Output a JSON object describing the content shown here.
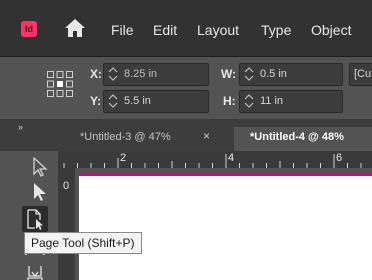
{
  "menubar": {
    "app_icon_text": "Id",
    "items": [
      "File",
      "Edit",
      "Layout",
      "Type",
      "Object"
    ]
  },
  "control_panel": {
    "x": {
      "label": "X:",
      "value": "8.25 in"
    },
    "y": {
      "label": "Y:",
      "value": "5.5 in"
    },
    "w": {
      "label": "W:",
      "value": "0.5 in"
    },
    "h": {
      "label": "H:",
      "value": "11 in"
    },
    "overflow_field": "[Cu"
  },
  "panel_toggle": "››",
  "tabs": [
    {
      "label": "*Untitled-3 @ 47%",
      "close": "×",
      "active": false
    },
    {
      "label": "*Untitled-4 @ 48%",
      "active": true
    }
  ],
  "ruler": {
    "h_marks": [
      "2",
      "4",
      "6"
    ],
    "v_marks": [
      "0"
    ]
  },
  "tooltip": "Page Tool (Shift+P)",
  "colors": {
    "app_icon": "#ff3366",
    "menubar_bg": "#323232",
    "panel_bg": "#535353",
    "margin_guide": "#d5007f"
  },
  "icons": [
    "home-icon",
    "reference-point-icon",
    "selection-tool-icon",
    "direct-selection-tool-icon",
    "page-tool-icon",
    "gap-tool-icon",
    "content-collector-icon"
  ]
}
